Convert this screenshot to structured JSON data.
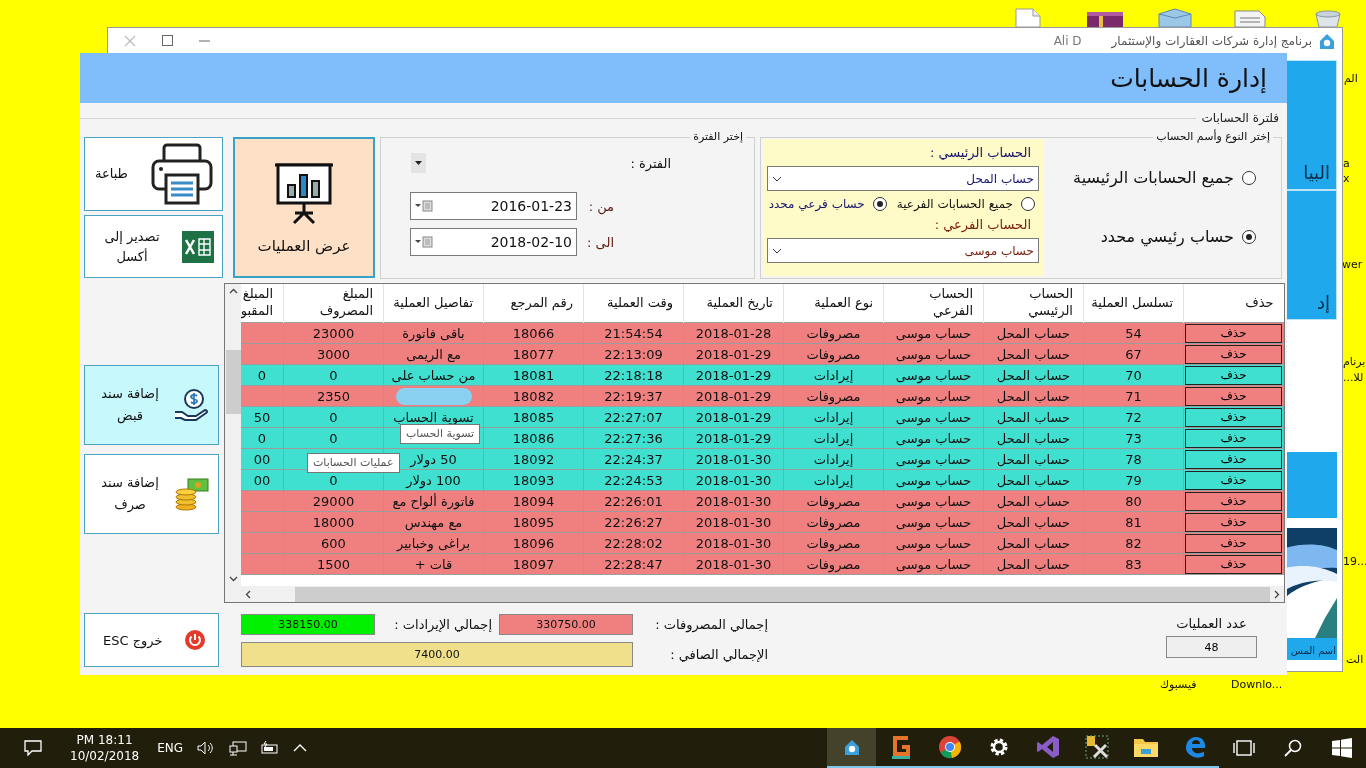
{
  "app_window": {
    "title": "برنامج إدارة شركات العقارات والإستثمار",
    "user": "Ali D",
    "tiles": [
      {
        "label": "البيا"
      },
      {
        "label": "إد"
      },
      {
        "label": "اسم المس"
      }
    ]
  },
  "desktop_labels": [
    "الم",
    "a",
    "x",
    "wer",
    "برنام",
    "...للا",
    "19...",
    "الت",
    "فيسبوك",
    "Downlo..."
  ],
  "form": {
    "title": "إدارة الحسابات",
    "filter_caption": "فلترة الحسابات",
    "account_group": {
      "legend": "إختر النوع وأسم الحساب",
      "scope_options": [
        {
          "label": "جميع الحسابات الرئيسية",
          "selected": false
        },
        {
          "label": "حساب رئيسي محدد",
          "selected": true
        }
      ],
      "main_account_label": "الحساب الرئيسي :",
      "main_account": "حساب المحل",
      "sub_options": [
        {
          "label": "جميع الحسابات الفرعية",
          "selected": false
        },
        {
          "label": "حساب فرعي محدد",
          "selected": true
        }
      ],
      "sub_account_label": "الحساب الفرعي :",
      "sub_account": "حساب موسى"
    },
    "period_group": {
      "legend": "إختر الفترة",
      "period_label": "الفترة :",
      "from_label": "من :",
      "from": "2016-01-23",
      "to_label": "الى :",
      "to": "2018-02-10"
    },
    "show_button": "عرض العمليات",
    "side_buttons": [
      {
        "kind": "print",
        "label": "طباعة"
      },
      {
        "kind": "excel",
        "label": "تصدير إلى أكسل"
      }
    ],
    "voucher_buttons": [
      {
        "kind": "receipt",
        "label": "إضافة سند قبض",
        "highlighted": true
      },
      {
        "kind": "payment",
        "label": "إضافة سند صرف",
        "highlighted": false
      }
    ],
    "table": {
      "columns": [
        "حذف",
        "تسلسل العملية",
        "الحساب الرئيسي",
        "الحساب الفرعي",
        "نوع العملية",
        "تاريخ العملية",
        "وقت العملية",
        "رقم المرجع",
        "تفاصيل العملية",
        "المبلغ المصروف",
        "المبلغ المقبو"
      ],
      "rows": [
        {
          "kind": "expense",
          "delete": "حذف",
          "serial": "54",
          "main_account": "حساب المحل",
          "sub_account": "حساب موسى",
          "type": "مصروفات",
          "date": "2018-01-28",
          "time": "21:54:54",
          "ref": "18066",
          "details": "باقى فاتورة",
          "spent": "23000"
        },
        {
          "kind": "expense",
          "delete": "حذف",
          "serial": "67",
          "main_account": "حساب المحل",
          "sub_account": "حساب موسى",
          "type": "مصروفات",
          "date": "2018-01-29",
          "time": "22:13:09",
          "ref": "18077",
          "details": "مع الريمى",
          "spent": "3000"
        },
        {
          "kind": "income",
          "delete": "حذف",
          "serial": "70",
          "main_account": "حساب المحل",
          "sub_account": "حساب موسى",
          "type": "إيرادات",
          "date": "2018-01-29",
          "time": "22:18:18",
          "ref": "18081",
          "details": "من حساب على",
          "spent": "0",
          "received": "0"
        },
        {
          "kind": "expense",
          "delete": "حذف",
          "serial": "71",
          "main_account": "حساب المحل",
          "sub_account": "حساب موسى",
          "type": "مصروفات",
          "date": "2018-01-29",
          "time": "22:19:37",
          "ref": "18082",
          "details_redacted": true,
          "spent": "2350"
        },
        {
          "kind": "income",
          "delete": "حذف",
          "serial": "72",
          "main_account": "حساب المحل",
          "sub_account": "حساب موسى",
          "type": "إيرادات",
          "date": "2018-01-29",
          "time": "22:27:07",
          "ref": "18085",
          "details": "تسوية الحساب",
          "spent": "0",
          "received": "50"
        },
        {
          "kind": "income",
          "delete": "حذف",
          "serial": "73",
          "main_account": "حساب المحل",
          "sub_account": "حساب موسى",
          "type": "إيرادات",
          "date": "2018-01-29",
          "time": "22:27:36",
          "ref": "18086",
          "spent": "0",
          "received": "0"
        },
        {
          "kind": "income",
          "delete": "حذف",
          "serial": "78",
          "main_account": "حساب المحل",
          "sub_account": "حساب موسى",
          "type": "إيرادات",
          "date": "2018-01-30",
          "time": "22:24:37",
          "ref": "18092",
          "details": "50 دولار",
          "received": "00"
        },
        {
          "kind": "income",
          "delete": "حذف",
          "serial": "79",
          "main_account": "حساب المحل",
          "sub_account": "حساب موسى",
          "type": "إيرادات",
          "date": "2018-01-30",
          "time": "22:24:53",
          "ref": "18093",
          "details": "100 دولار",
          "spent": "0",
          "received": "00"
        },
        {
          "kind": "expense",
          "delete": "حذف",
          "serial": "80",
          "main_account": "حساب المحل",
          "sub_account": "حساب موسى",
          "type": "مصروفات",
          "date": "2018-01-30",
          "time": "22:26:01",
          "ref": "18094",
          "details": "فاتورة ألواح مع",
          "spent": "29000"
        },
        {
          "kind": "expense",
          "delete": "حذف",
          "serial": "81",
          "main_account": "حساب المحل",
          "sub_account": "حساب موسى",
          "type": "مصروفات",
          "date": "2018-01-30",
          "time": "22:26:27",
          "ref": "18095",
          "details": "مع مهندس",
          "spent": "18000"
        },
        {
          "kind": "expense",
          "delete": "حذف",
          "serial": "82",
          "main_account": "حساب المحل",
          "sub_account": "حساب موسى",
          "type": "مصروفات",
          "date": "2018-01-30",
          "time": "22:28:02",
          "ref": "18096",
          "details": "براغى وخبابير",
          "spent": "600"
        },
        {
          "kind": "expense",
          "delete": "حذف",
          "serial": "83",
          "main_account": "حساب المحل",
          "sub_account": "حساب موسى",
          "type": "مصروفات",
          "date": "2018-01-30",
          "time": "22:28:47",
          "ref": "18097",
          "details": "قات +",
          "spent": "1500"
        }
      ]
    },
    "tooltips": [
      "تسوية الحساب",
      "عمليات الحسابات"
    ],
    "exit_button": "خروج ESC",
    "totals": {
      "expenses_label": "إجمالي المصروفات :",
      "expenses": "330750.00",
      "income_label": "إجمالي الإيرادات :",
      "income": "338150.00",
      "net_label": "الإجمالي الصافي :",
      "net": "7400.00"
    },
    "count_label": "عدد العمليات",
    "count": "48"
  },
  "taskbar": {
    "time": "PM 18:11",
    "date": "10/02/2018",
    "language": "ENG",
    "apps": [
      {
        "kind": "house",
        "selected": true
      },
      {
        "kind": "pos",
        "selected": false
      },
      {
        "kind": "chrome",
        "selected": false
      },
      {
        "kind": "gear",
        "selected": false
      },
      {
        "kind": "studio",
        "selected": false
      },
      {
        "kind": "tools",
        "selected": false
      },
      {
        "kind": "folder",
        "selected": false
      },
      {
        "kind": "edge",
        "selected": false
      }
    ]
  }
}
